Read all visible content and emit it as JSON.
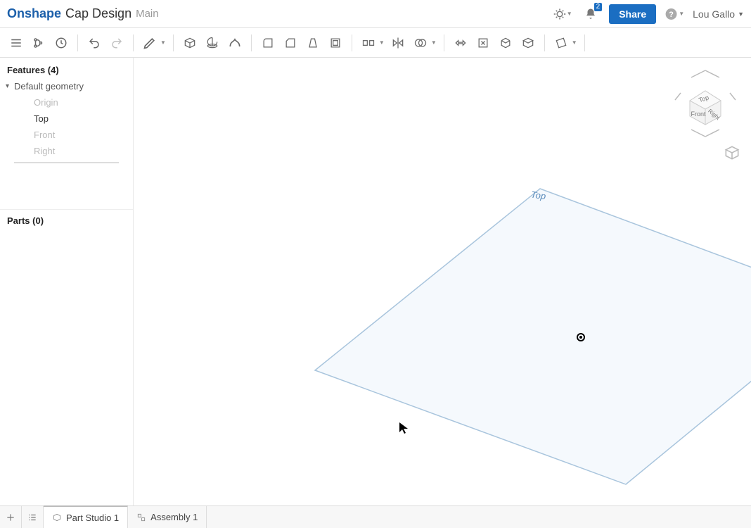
{
  "header": {
    "logo": "Onshape",
    "doc_title": "Cap Design",
    "branch": "Main",
    "share_label": "Share",
    "user_name": "Lou Gallo",
    "notification_count": "2"
  },
  "toolbar": {
    "groups": [
      [
        "menu",
        "branch",
        "history"
      ],
      [
        "undo",
        "redo"
      ],
      [
        "sketch"
      ],
      [
        "extrude",
        "revolve",
        "sweep"
      ],
      [
        "fillet",
        "chamfer",
        "draft",
        "shell"
      ],
      [
        "pattern",
        "mirror",
        "boolean"
      ],
      [
        "transform",
        "delete-face",
        "move-face",
        "import"
      ],
      [
        "plane"
      ]
    ]
  },
  "sidebar": {
    "features_label": "Features (4)",
    "default_geometry_label": "Default geometry",
    "items": [
      {
        "label": "Origin",
        "dim": true
      },
      {
        "label": "Top",
        "dim": false
      },
      {
        "label": "Front",
        "dim": true
      },
      {
        "label": "Right",
        "dim": true
      }
    ],
    "parts_label": "Parts (0)"
  },
  "canvas": {
    "plane_label": "Top",
    "cube_faces": {
      "top": "Top",
      "front": "Front",
      "right": "Right"
    }
  },
  "tabs": {
    "items": [
      {
        "label": "Part Studio 1",
        "icon": "part-studio",
        "active": true
      },
      {
        "label": "Assembly 1",
        "icon": "assembly",
        "active": false
      }
    ]
  }
}
